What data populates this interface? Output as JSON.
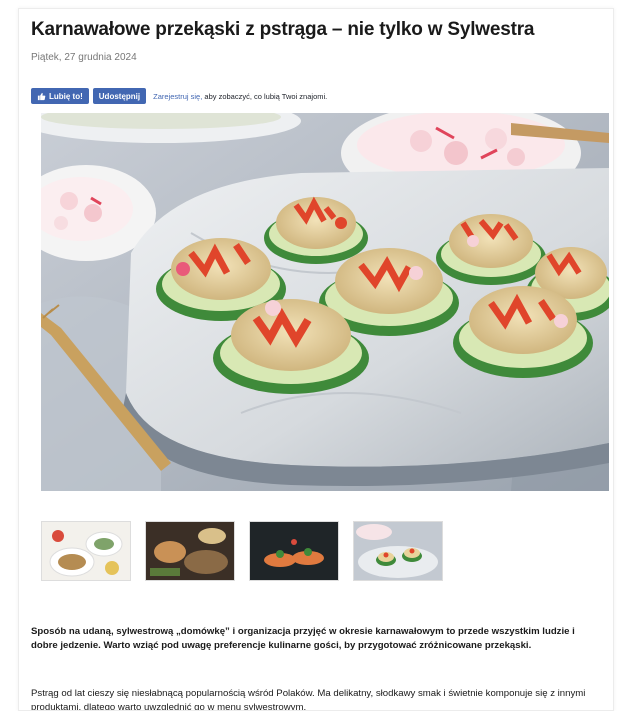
{
  "article": {
    "title": "Karnawałowe przekąski z pstrąga – nie tylko w Sylwestra",
    "date": "Piątek, 27 grudnia 2024"
  },
  "facebook": {
    "like_label": "Lubię to!",
    "share_label": "Udostępnij",
    "signup_link": "Zarejestruj się,",
    "signup_text": " aby zobaczyć, co lubią Twoi znajomi."
  },
  "gallery": {
    "thumbnail_count": 4
  },
  "body": {
    "paragraph_1": "Sposób na udaną, sylwestrową „domówkę” i organizacja przyjęć w okresie karnawałowym to przede wszystkim ludzie i dobre jedzenie. Warto wziąć pod uwagę preferencje kulinarne gości, by przygotować zróżnicowane przekąski.",
    "paragraph_2": "Pstrąg od lat cieszy się niesłabnącą popularnością wśród Polaków. Ma delikatny, słodkawy smak i świetnie komponuje się z innymi produktami, dlatego warto uwzględnić go w menu sylwestrowym."
  },
  "colors": {
    "facebook_blue": "#4267b2",
    "cucumber_green": "#3f8a3a",
    "salmon_red": "#e0452b"
  }
}
